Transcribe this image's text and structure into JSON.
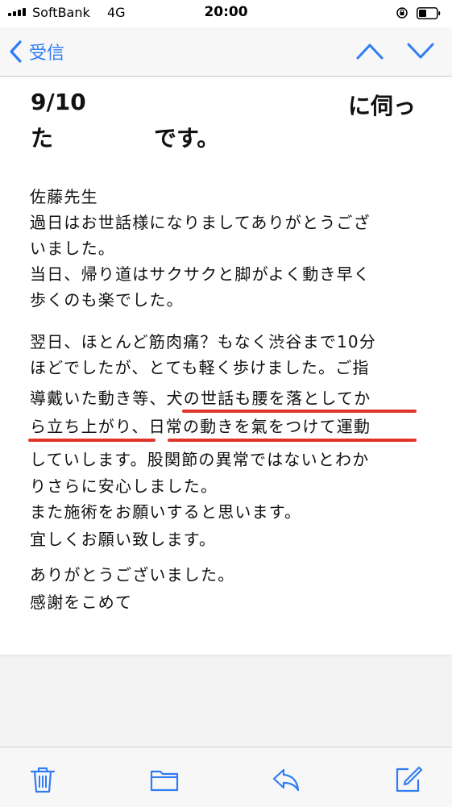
{
  "status_bar": {
    "carrier": "SoftBank",
    "network": "4G",
    "time": "20:00"
  },
  "nav": {
    "back_label": "受信",
    "back_icon": "chevron-left-icon",
    "prev_icon": "chevron-up-icon",
    "next_icon": "chevron-down-icon",
    "accent_color": "#2f7cf6"
  },
  "email": {
    "subject_parts": [
      "9/10",
      "に伺っ",
      "た",
      "です。"
    ],
    "body_lines": [
      "佐藤先生",
      "過日はお世話様になりましてありがとうござ",
      "いました。",
      "当日、帰り道はサクサクと脚がよく動き早く",
      "歩くのも楽でした。",
      "翌日、ほとんど筋肉痛？もなく渋谷まで10分",
      "ほどでしたが、とても軽く歩けました。ご指",
      "導戴いた動き等、犬の世話も腰を落としてか",
      "ら立ち上がり、日常の動きを氣をつけて運動",
      "していします。股関節の異常ではないとわか",
      "りさらに安心しました。",
      "また施術をお願いすると思います。",
      "宜しくお願い致します。",
      "ありがとうございました。",
      "感謝をこめて"
    ],
    "highlight_color": "#e0352a"
  },
  "toolbar": {
    "icons": [
      "trash-icon",
      "folder-icon",
      "reply-icon",
      "compose-icon"
    ]
  }
}
